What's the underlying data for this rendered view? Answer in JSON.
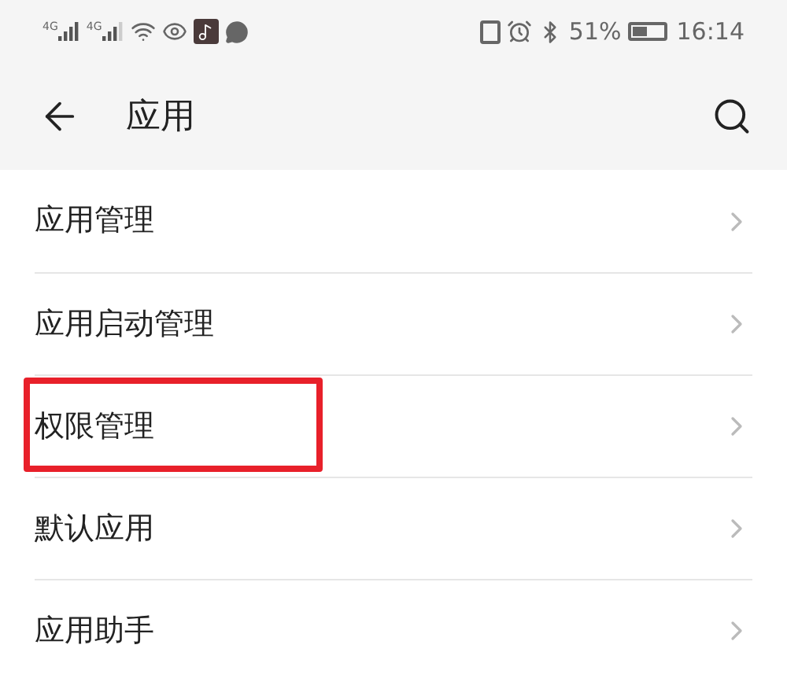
{
  "status_bar": {
    "signals": [
      "4G",
      "4G"
    ],
    "battery": "51%",
    "time": "16:14"
  },
  "header": {
    "title": "应用"
  },
  "items": [
    {
      "label": "应用管理",
      "highlighted": false
    },
    {
      "label": "应用启动管理",
      "highlighted": false
    },
    {
      "label": "权限管理",
      "highlighted": true
    },
    {
      "label": "默认应用",
      "highlighted": false
    },
    {
      "label": "应用助手",
      "highlighted": false
    }
  ]
}
